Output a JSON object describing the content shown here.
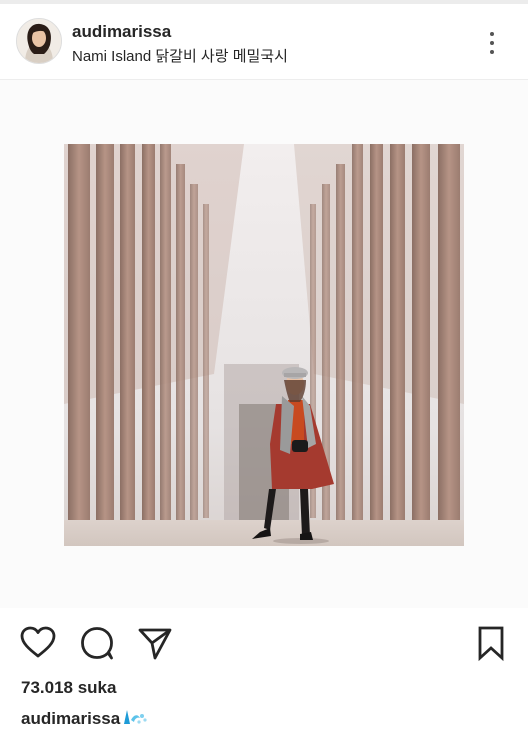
{
  "post": {
    "username": "audimarissa",
    "location": "Nami Island 닭갈비 사랑 메밀국시",
    "likes_text": "73.018 suka",
    "caption_user": "audimarissa"
  },
  "icons": {
    "avatar": "profile-avatar",
    "more": "more-options-icon",
    "like": "heart-icon",
    "comment": "comment-icon",
    "share": "send-icon",
    "save": "bookmark-icon",
    "caption_emoji": "wave-emoji"
  },
  "colors": {
    "text": "#262626",
    "divider": "#ededed",
    "emoji": "#1e9bd7"
  }
}
